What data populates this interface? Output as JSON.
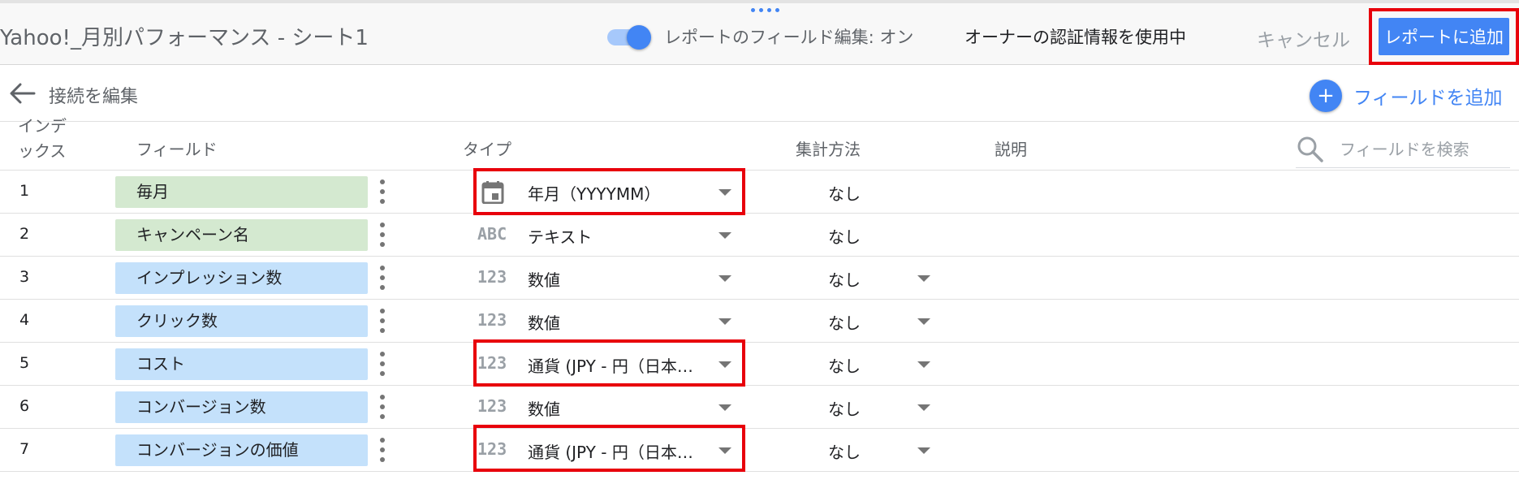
{
  "header": {
    "title": "Yahoo!_月別パフォーマンス - シート1",
    "toggle_label": "レポートのフィールド編集: オン",
    "toggle_on": true,
    "owner_credentials": "オーナーの認証情報を使用中",
    "cancel_label": "キャンセル",
    "add_to_report_label": "レポートに追加"
  },
  "subbar": {
    "edit_connection_label": "接続を編集",
    "add_field_label": "フィールドを追加"
  },
  "table": {
    "headers": {
      "index": "インデックス",
      "field": "フィールド",
      "type": "タイプ",
      "aggregation": "集計方法",
      "description": "説明"
    },
    "search_placeholder": "フィールドを検索",
    "rows": [
      {
        "index": "1",
        "field": "毎月",
        "kind": "dimension",
        "type_icon": "calendar-icon",
        "type": "年月（YYYYMM）",
        "aggregation": "なし",
        "agg_dropdown": false
      },
      {
        "index": "2",
        "field": "キャンペーン名",
        "kind": "dimension",
        "type_icon": "abc-text-icon",
        "type_glyph": "ABC",
        "type": "テキスト",
        "aggregation": "なし",
        "agg_dropdown": false
      },
      {
        "index": "3",
        "field": "インプレッション数",
        "kind": "metric",
        "type_icon": "number-123-icon",
        "type_glyph": "123",
        "type": "数値",
        "aggregation": "なし",
        "agg_dropdown": true
      },
      {
        "index": "4",
        "field": "クリック数",
        "kind": "metric",
        "type_icon": "number-123-icon",
        "type_glyph": "123",
        "type": "数値",
        "aggregation": "なし",
        "agg_dropdown": true
      },
      {
        "index": "5",
        "field": "コスト",
        "kind": "metric",
        "type_icon": "number-123-icon",
        "type_glyph": "123",
        "type": "通貨 (JPY - 円（日本）...",
        "aggregation": "なし",
        "agg_dropdown": true
      },
      {
        "index": "6",
        "field": "コンバージョン数",
        "kind": "metric",
        "type_icon": "number-123-icon",
        "type_glyph": "123",
        "type": "数値",
        "aggregation": "なし",
        "agg_dropdown": true
      },
      {
        "index": "7",
        "field": "コンバージョンの価値",
        "kind": "metric",
        "type_icon": "number-123-icon",
        "type_glyph": "123",
        "type": "通貨 (JPY - 円（日本）...",
        "aggregation": "なし",
        "agg_dropdown": true
      }
    ]
  },
  "colors": {
    "accent": "#4285f4",
    "dimension_chip": "#d4e9d0",
    "metric_chip": "#c4e1fb",
    "highlight_box": "#e8000b"
  }
}
